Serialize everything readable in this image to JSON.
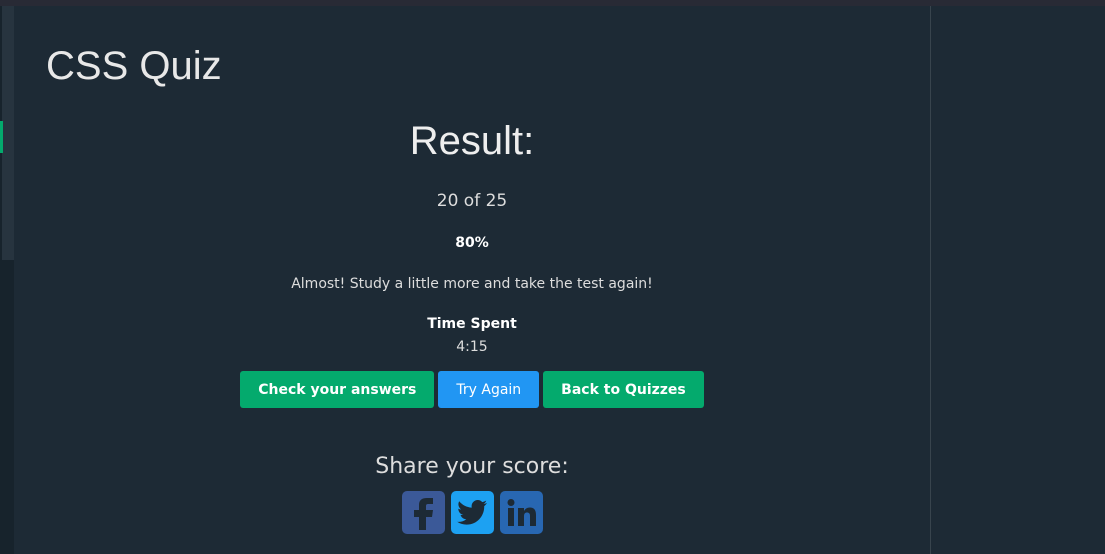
{
  "page": {
    "title": "CSS Quiz"
  },
  "result": {
    "heading": "Result:",
    "score": "20 of 25",
    "percent": "80%",
    "message": "Almost! Study a little more and take the test again!",
    "time_label": "Time Spent",
    "time_value": "4:15"
  },
  "buttons": {
    "check": "Check your answers",
    "retry": "Try Again",
    "back": "Back to Quizzes"
  },
  "share": {
    "title": "Share your score:",
    "icons": [
      "facebook-icon",
      "twitter-icon",
      "linkedin-icon"
    ]
  },
  "colors": {
    "background": "#1d2a35",
    "green": "#04aa6d",
    "blue": "#2196f3",
    "facebook": "#3b5998",
    "twitter": "#1da1f2",
    "linkedin": "#2867b2"
  }
}
